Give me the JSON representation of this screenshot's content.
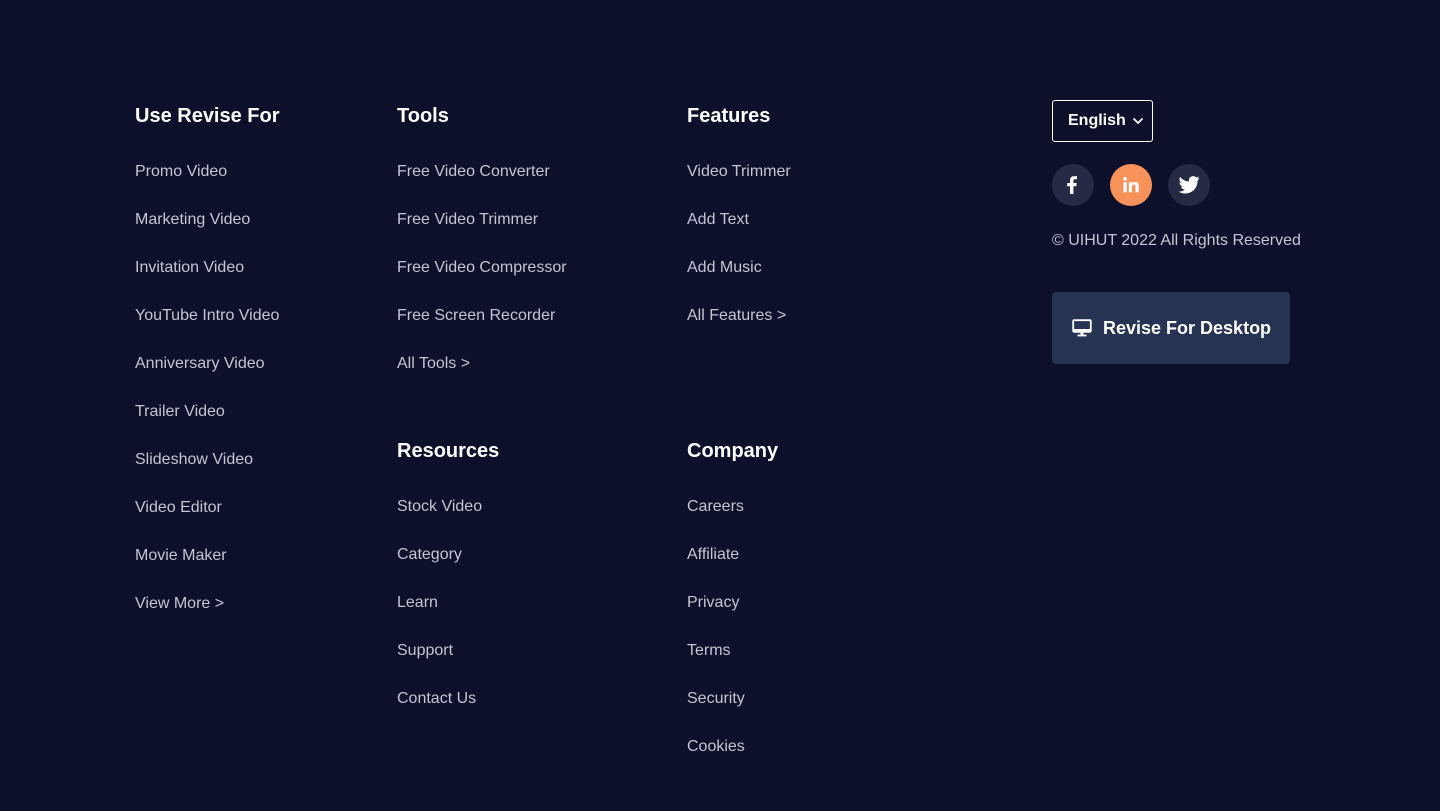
{
  "columns": {
    "use_revise_for": {
      "heading": "Use Revise For",
      "links": [
        "Promo Video",
        "Marketing Video",
        "Invitation Video",
        "YouTube Intro Video",
        "Anniversary Video",
        "Trailer Video",
        "Slideshow Video",
        "Video Editor",
        "Movie Maker",
        "View More >"
      ]
    },
    "tools": {
      "heading": "Tools",
      "links": [
        "Free Video Converter",
        "Free Video Trimmer",
        "Free Video Compressor",
        "Free Screen Recorder",
        "All Tools >"
      ]
    },
    "features": {
      "heading": "Features",
      "links": [
        "Video Trimmer",
        "Add Text",
        "Add Music",
        "All Features >"
      ]
    },
    "resources": {
      "heading": "Resources",
      "links": [
        "Stock Video",
        "Category",
        "Learn",
        "Support",
        "Contact Us"
      ]
    },
    "company": {
      "heading": "Company",
      "links": [
        "Careers",
        "Affiliate",
        "Privacy",
        "Terms",
        "Security",
        "Cookies"
      ]
    }
  },
  "language": {
    "selected": "English",
    "icon": "chevron-down-icon"
  },
  "social": [
    {
      "name": "facebook",
      "icon": "facebook-icon",
      "color": "#262b45"
    },
    {
      "name": "linkedin",
      "icon": "linkedin-icon",
      "color": "#f7935a"
    },
    {
      "name": "twitter",
      "icon": "twitter-icon",
      "color": "#262b45"
    }
  ],
  "copyright": "© UIHUT 2022 All Rights Reserved",
  "desktop_button": {
    "label": "Revise For Desktop",
    "icon": "monitor-icon"
  },
  "colors": {
    "background": "#0c102a",
    "accent": "#f7935a",
    "button": "#273352"
  }
}
